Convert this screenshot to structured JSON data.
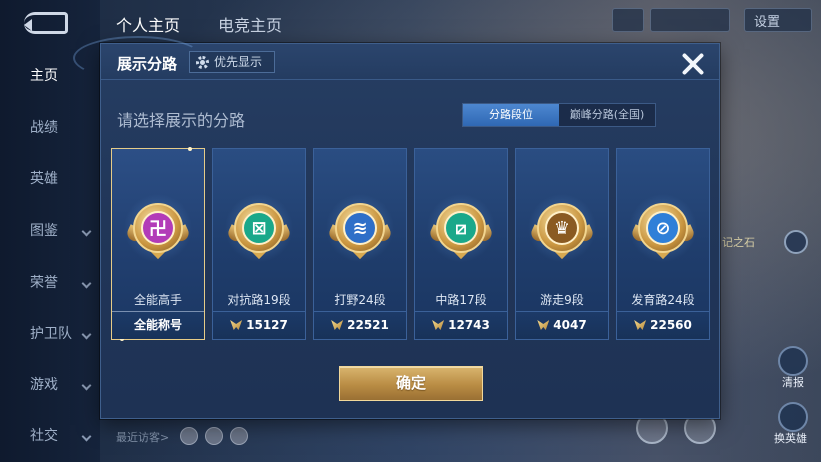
{
  "background": {
    "nav_items": [
      {
        "label": "主页",
        "active": true
      },
      {
        "label": "战绩",
        "chevron": false
      },
      {
        "label": "英雄",
        "chevron": false
      },
      {
        "label": "图鉴",
        "chevron": true
      },
      {
        "label": "荣誉",
        "chevron": true
      },
      {
        "label": "护卫队",
        "chevron": true
      },
      {
        "label": "游戏",
        "chevron": true
      },
      {
        "label": "社交",
        "chevron": true
      }
    ],
    "top_tabs": [
      "个人主页",
      "电竞主页"
    ],
    "settings_label": "设置",
    "side_label": "记之石",
    "float_buttons": [
      "清报",
      "换英雄"
    ],
    "recent_visitors_label": "最近访客>"
  },
  "modal": {
    "title": "展示分路",
    "priority_button": "优先显示",
    "prompt": "请选择展示的分路",
    "tabs": [
      {
        "label": "分路段位",
        "active": true
      },
      {
        "label": "巅峰分路(全国)",
        "active": false
      }
    ],
    "cards": [
      {
        "name": "全能高手",
        "footer": "全能称号",
        "points": "",
        "selected": true,
        "symbol": "卍",
        "core_color": "#b23bb8",
        "emblem_icon": "all-round-emblem-icon"
      },
      {
        "name": "对抗路19段",
        "footer": "",
        "points": "15127",
        "selected": false,
        "symbol": "⊠",
        "core_color": "#1aa88a",
        "emblem_icon": "clash-lane-emblem-icon"
      },
      {
        "name": "打野24段",
        "footer": "",
        "points": "22521",
        "selected": false,
        "symbol": "≋",
        "core_color": "#2f6fc8",
        "emblem_icon": "jungle-emblem-icon"
      },
      {
        "name": "中路17段",
        "footer": "",
        "points": "12743",
        "selected": false,
        "symbol": "⧄",
        "core_color": "#1aa88a",
        "emblem_icon": "mid-lane-emblem-icon"
      },
      {
        "name": "游走9段",
        "footer": "",
        "points": "4047",
        "selected": false,
        "symbol": "♛",
        "core_color": "#8a5a22",
        "emblem_icon": "roam-emblem-icon"
      },
      {
        "name": "发育路24段",
        "footer": "",
        "points": "22560",
        "selected": false,
        "symbol": "⊘",
        "core_color": "#2f7fd8",
        "emblem_icon": "farm-lane-emblem-icon"
      }
    ],
    "confirm_label": "确定"
  }
}
